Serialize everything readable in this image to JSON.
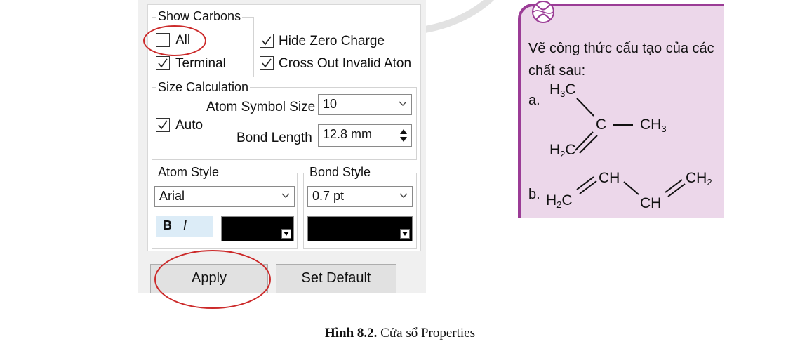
{
  "dialog": {
    "show_carbons": {
      "title": "Show Carbons",
      "all_label": "All",
      "all_checked": false,
      "terminal_label": "Terminal",
      "terminal_checked": true,
      "hide_zero_charge_label": "Hide Zero Charge",
      "hide_zero_charge_checked": true,
      "cross_out_label": "Cross Out Invalid Aton",
      "cross_out_checked": true
    },
    "size_calculation": {
      "title": "Size Calculation",
      "atom_symbol_size_label": "Atom Symbol Size",
      "atom_symbol_size_value": "10",
      "auto_label": "Auto",
      "auto_checked": true,
      "bond_length_label": "Bond Length",
      "bond_length_value": "12.8 mm"
    },
    "atom_style": {
      "title": "Atom Style",
      "font_value": "Arial",
      "bold_label": "B",
      "italic_label": "I",
      "color": "#000000"
    },
    "bond_style": {
      "title": "Bond Style",
      "width_value": "0.7 pt",
      "color": "#000000"
    },
    "buttons": {
      "apply": "Apply",
      "set_default": "Set Default"
    }
  },
  "caption": {
    "bold": "Hình 8.2.",
    "text": " Cửa sổ Properties"
  },
  "exercise": {
    "prompt_line1": "Vẽ công thức cấu tạo của các",
    "prompt_line2": "chất sau:",
    "a_label": "a.",
    "b_label": "b.",
    "a": {
      "h3c": "H",
      "h3c_sub": "3",
      "h3c_c": "C",
      "c": "C",
      "ch3": "CH",
      "ch3_sub": "3",
      "h2c": "H",
      "h2c_sub": "2",
      "h2c_c": "C"
    },
    "b": {
      "h2c": "H",
      "h2c_sub": "2",
      "h2c_c": "C",
      "ch1": "CH",
      "ch2": "CH",
      "ch2_end": "CH",
      "ch2_end_sub": "2"
    },
    "accent_color": "#9b3c96",
    "card_color": "#ecd7ea"
  },
  "annotation_color": "#cc2a2a"
}
